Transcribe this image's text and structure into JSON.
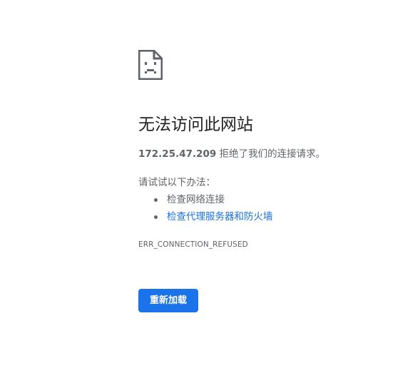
{
  "error_page": {
    "icon": "sad-page-icon",
    "title": "无法访问此网站",
    "message": {
      "host": "172.25.47.209",
      "text": " 拒绝了我们的连接请求。"
    },
    "suggestions_heading": "请试试以下办法：",
    "suggestions": [
      {
        "label": "检查网络连接",
        "is_link": false
      },
      {
        "label": "检查代理服务器和防火墙",
        "is_link": true
      }
    ],
    "error_code": "ERR_CONNECTION_REFUSED",
    "reload_button_label": "重新加载"
  },
  "colors": {
    "title": "#202124",
    "body_text": "#5f6368",
    "link": "#1a73e8",
    "button_bg": "#1a73e8",
    "button_text": "#ffffff"
  }
}
